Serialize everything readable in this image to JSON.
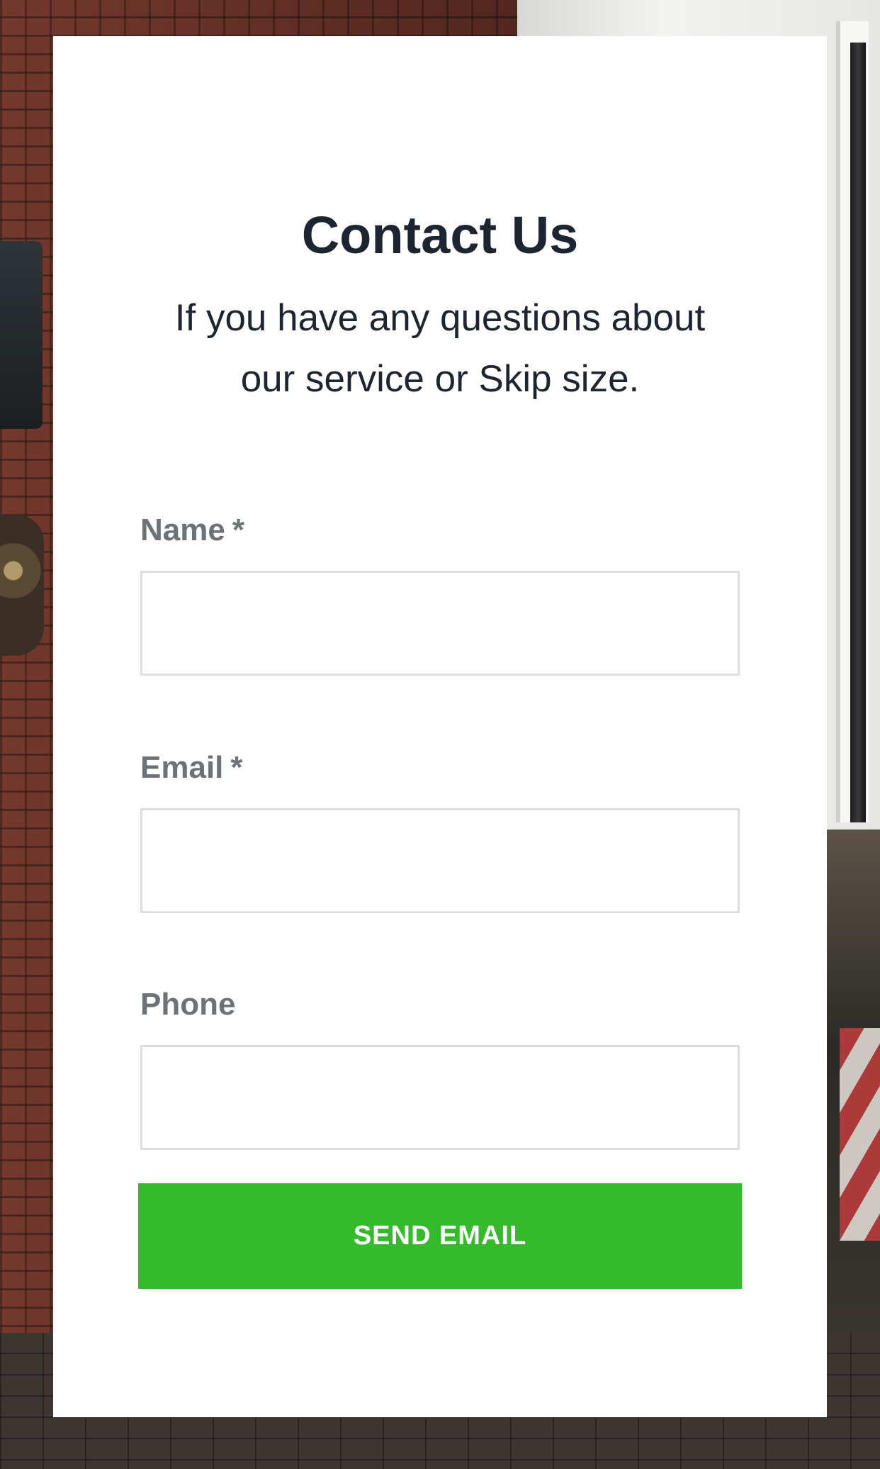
{
  "form": {
    "title": "Contact Us",
    "subtitle": "If you have any questions about our service or Skip size.",
    "fields": [
      {
        "label": "Name",
        "required_marker": "*",
        "value": ""
      },
      {
        "label": "Email",
        "required_marker": "*",
        "value": ""
      },
      {
        "label": "Phone",
        "required_marker": "",
        "value": ""
      }
    ],
    "submit_label": "SEND EMAIL"
  },
  "colors": {
    "accent_button": "#34bb2b",
    "title_text": "#1d2530",
    "label_text": "#6d7278",
    "input_border": "#dedede",
    "card_background": "#ffffff"
  }
}
